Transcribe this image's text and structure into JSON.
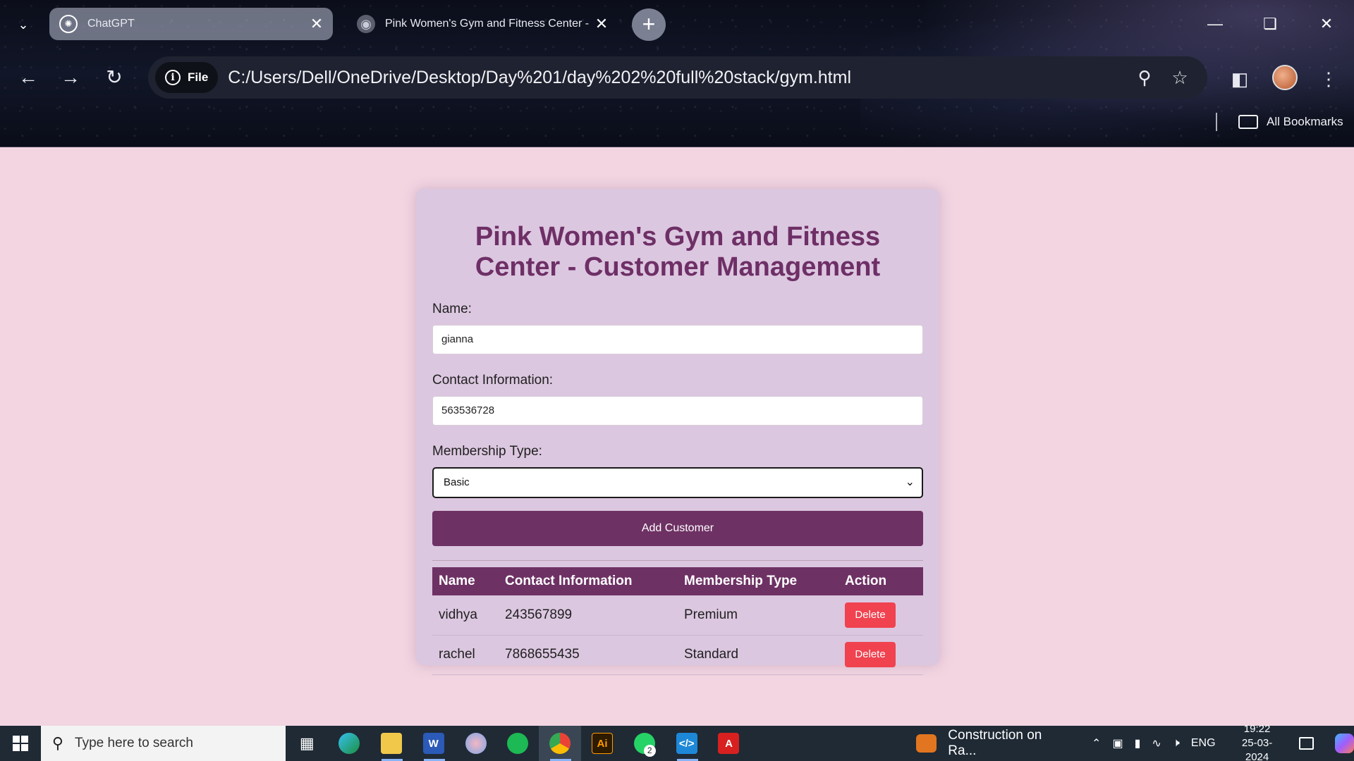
{
  "browser": {
    "tabs": [
      {
        "title": "ChatGPT",
        "active": true
      },
      {
        "title": "Pink Women's Gym and Fitness Center - C",
        "active": false
      }
    ],
    "address": {
      "chip": "File",
      "url": "C:/Users/Dell/OneDrive/Desktop/Day%201/day%202%20full%20stack/gym.html"
    },
    "bookmarks_label": "All Bookmarks"
  },
  "page": {
    "title": "Pink Women's Gym and Fitness Center - Customer Management",
    "form": {
      "name_label": "Name:",
      "name_value": "gianna",
      "contact_label": "Contact Information:",
      "contact_value": "563536728",
      "membership_label": "Membership Type:",
      "membership_value": "Basic",
      "submit_label": "Add Customer"
    },
    "table": {
      "headers": [
        "Name",
        "Contact Information",
        "Membership Type",
        "Action"
      ],
      "rows": [
        {
          "name": "vidhya",
          "contact": "243567899",
          "membership": "Premium",
          "action": "Delete"
        },
        {
          "name": "rachel",
          "contact": "7868655435",
          "membership": "Standard",
          "action": "Delete"
        }
      ]
    }
  },
  "taskbar": {
    "search_placeholder": "Type here to search",
    "whatsapp_badge": "2",
    "news": "Construction on Ra...",
    "language": "ENG",
    "time": "19:22",
    "date": "25-03-2024"
  },
  "colors": {
    "page_bg": "#f2d5e1",
    "card_bg": "#dcc7e0",
    "accent": "#6e3164",
    "delete": "#f0424f"
  }
}
